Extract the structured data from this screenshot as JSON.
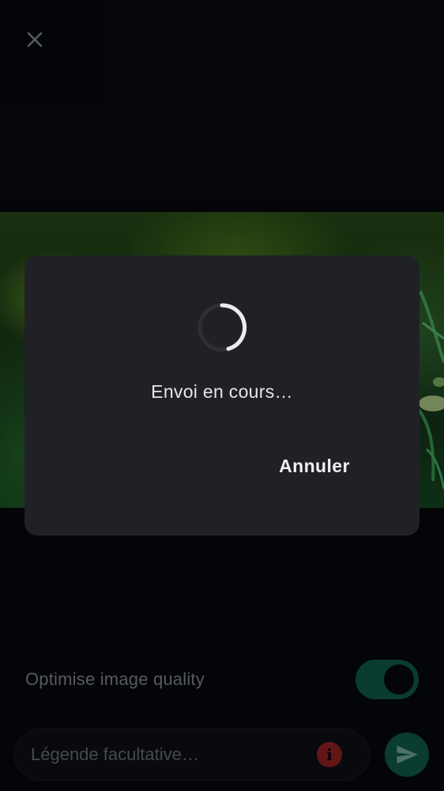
{
  "header": {
    "close_icon": "close-icon"
  },
  "options": {
    "optimise_label": "Optimise image quality",
    "optimise_enabled": true
  },
  "composer": {
    "caption_placeholder": "Légende facultative…",
    "caption_value": "",
    "warning_icon": "info-icon",
    "send_icon": "send-icon"
  },
  "dialog": {
    "message": "Envoi en cours…",
    "cancel_label": "Annuler",
    "spinner_icon": "progress-spinner"
  },
  "colors": {
    "background": "#05070b",
    "dialog_bg": "#202126",
    "accent": "#0d4a3c",
    "warning": "#7a1c1c"
  }
}
